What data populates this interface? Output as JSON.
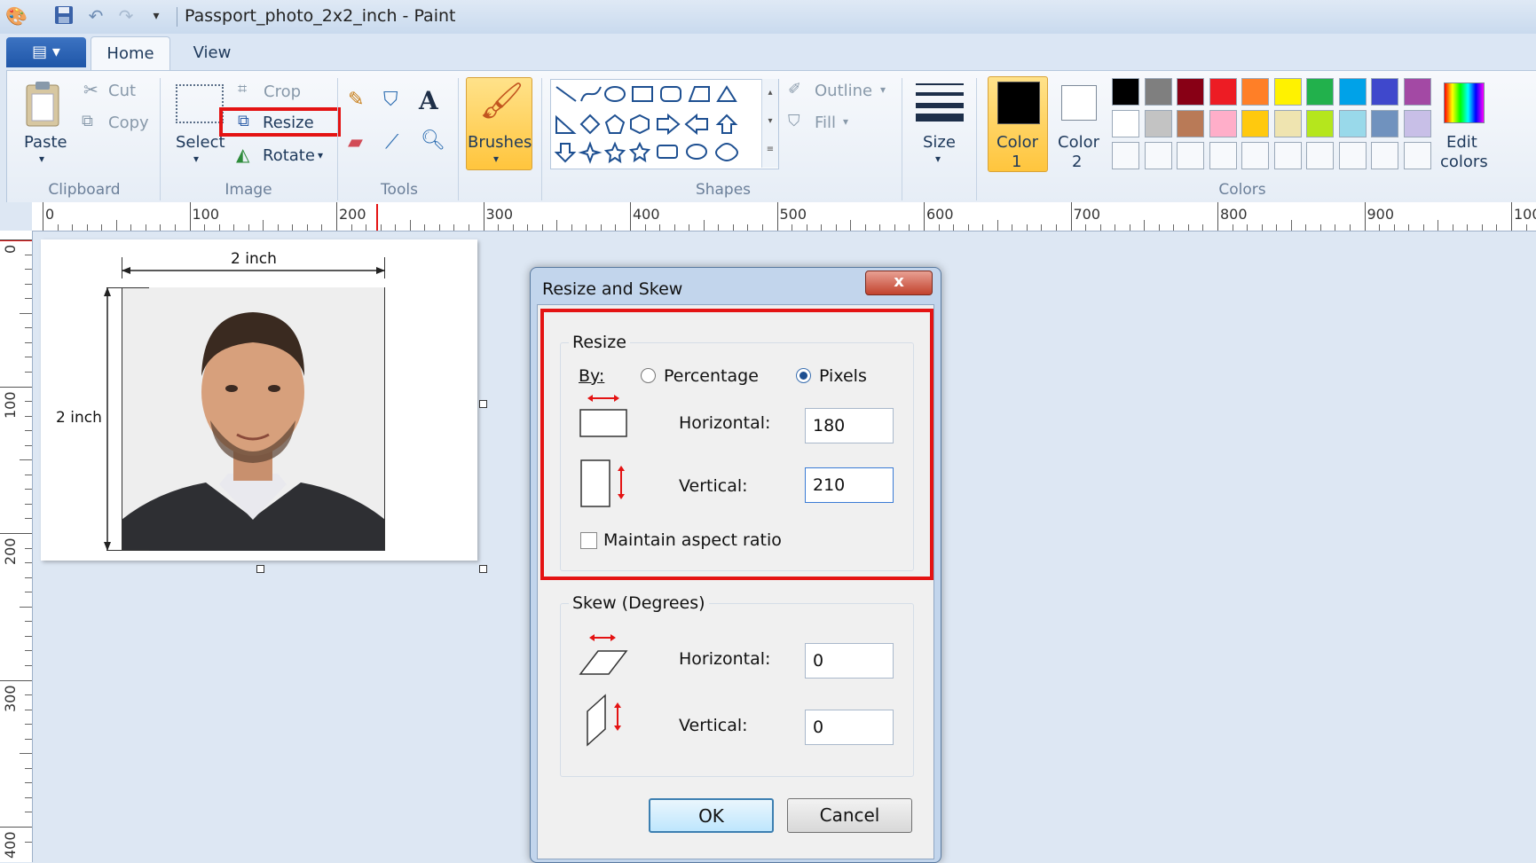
{
  "window": {
    "title": "Passport_photo_2x2_inch - Paint"
  },
  "tabs": {
    "home": "Home",
    "view": "View"
  },
  "clipboard": {
    "paste": "Paste",
    "cut": "Cut",
    "copy": "Copy",
    "group": "Clipboard"
  },
  "image_group": {
    "select": "Select",
    "crop": "Crop",
    "resize": "Resize",
    "rotate": "Rotate",
    "group": "Image"
  },
  "tools": {
    "group": "Tools",
    "text_glyph": "A"
  },
  "brushes": {
    "label": "Brushes"
  },
  "shapes": {
    "outline": "Outline",
    "fill": "Fill",
    "group": "Shapes"
  },
  "size": {
    "label": "Size"
  },
  "colors": {
    "color1_label": "Color",
    "color1_num": "1",
    "color2_label": "Color",
    "color2_num": "2",
    "edit_line1": "Edit",
    "edit_line2": "colors",
    "group": "Colors",
    "color1_value": "#000000",
    "color2_value": "#ffffff",
    "palette_row1": [
      "#000000",
      "#7f7f7f",
      "#880015",
      "#ed1c24",
      "#ff7f27",
      "#fff200",
      "#22b14c",
      "#00a2e8",
      "#3f48cc",
      "#a349a4"
    ],
    "palette_row2": [
      "#ffffff",
      "#c3c3c3",
      "#b97a57",
      "#ffaec9",
      "#ffc90e",
      "#efe4b0",
      "#b5e61d",
      "#99d9ea",
      "#7092be",
      "#c8bfe7"
    ]
  },
  "ruler": {
    "h_labels": [
      "0",
      "100",
      "200",
      "300",
      "400",
      "500",
      "600",
      "700",
      "800",
      "900",
      "100"
    ],
    "v_labels": [
      "0",
      "100",
      "200",
      "300",
      "400"
    ]
  },
  "photo": {
    "width_label": "2 inch",
    "height_label": "2 inch"
  },
  "dialog": {
    "title": "Resize and Skew",
    "resize_legend": "Resize",
    "by_label": "By:",
    "percentage": "Percentage",
    "pixels": "Pixels",
    "horizontal_label": "Horizontal:",
    "horizontal_value": "180",
    "vertical_label": "Vertical:",
    "vertical_value": "210",
    "maintain": "Maintain aspect ratio",
    "skew_legend": "Skew (Degrees)",
    "skew_h_label": "Horizontal:",
    "skew_h_value": "0",
    "skew_v_label": "Vertical:",
    "skew_v_value": "0",
    "ok": "OK",
    "cancel": "Cancel",
    "close_glyph": "x"
  }
}
